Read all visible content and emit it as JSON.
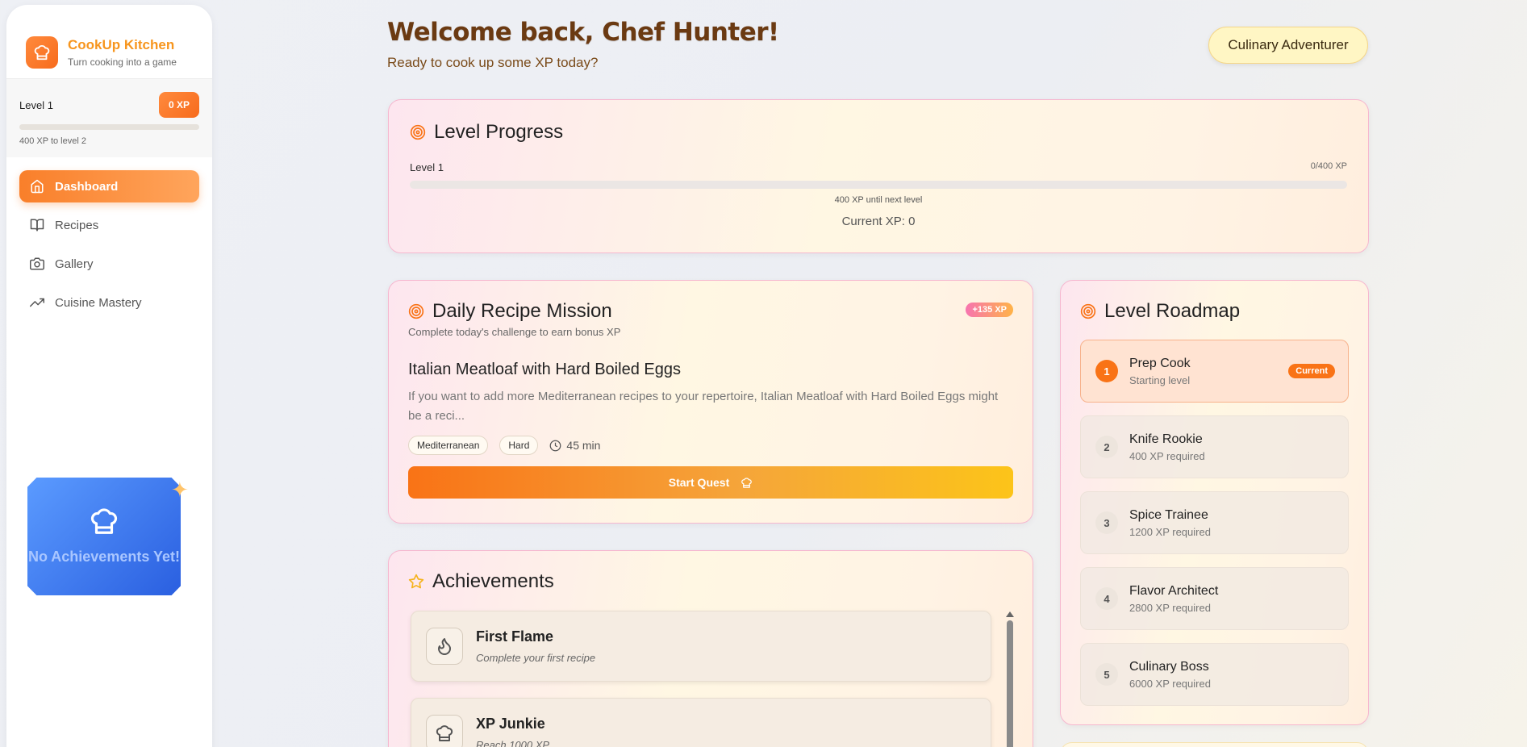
{
  "brand": {
    "title": "CookUp Kitchen",
    "subtitle": "Turn cooking into a game"
  },
  "sidebar_level": {
    "label": "Level 1",
    "xp": "0 XP",
    "hint": "400 XP to level 2",
    "progress": 0
  },
  "nav": [
    {
      "label": "Dashboard",
      "icon": "home-icon",
      "active": true
    },
    {
      "label": "Recipes",
      "icon": "book-icon"
    },
    {
      "label": "Gallery",
      "icon": "camera-icon"
    },
    {
      "label": "Cuisine Mastery",
      "icon": "trending-up-icon"
    }
  ],
  "achievement_badge": {
    "text": "No Achievements Yet!"
  },
  "header": {
    "title": "Welcome back, Chef Hunter!",
    "subtitle": "Ready to cook up some XP today?",
    "rank": "Culinary Adventurer"
  },
  "level_progress": {
    "title": "Level Progress",
    "level": "Level 1",
    "xp_fraction": "0/400 XP",
    "hint": "400 XP until next level",
    "current": "Current XP: 0",
    "progress": 0
  },
  "mission": {
    "title": "Daily Recipe Mission",
    "bonus": "+135 XP",
    "subtitle": "Complete today's challenge to earn bonus XP",
    "recipe_title": "Italian Meatloaf with Hard Boiled Eggs",
    "description": "If you want to add more Mediterranean recipes to your repertoire, Italian Meatloaf with Hard Boiled Eggs might be a reci...",
    "tags": [
      "Mediterranean",
      "Hard"
    ],
    "time": "45 min",
    "button": "Start Quest"
  },
  "achievements": {
    "title": "Achievements",
    "items": [
      {
        "name": "First Flame",
        "desc": "Complete your first recipe",
        "icon": "flame-icon"
      },
      {
        "name": "XP Junkie",
        "desc": "Reach 1000 XP",
        "icon": "chef-hat-icon"
      }
    ]
  },
  "roadmap": {
    "title": "Level Roadmap",
    "current_label": "Current",
    "items": [
      {
        "num": "1",
        "name": "Prep Cook",
        "req": "Starting level",
        "current": true
      },
      {
        "num": "2",
        "name": "Knife Rookie",
        "req": "400 XP required"
      },
      {
        "num": "3",
        "name": "Spice Trainee",
        "req": "1200 XP required"
      },
      {
        "num": "4",
        "name": "Flavor Architect",
        "req": "2800 XP required"
      },
      {
        "num": "5",
        "name": "Culinary Boss",
        "req": "6000 XP required"
      }
    ]
  }
}
